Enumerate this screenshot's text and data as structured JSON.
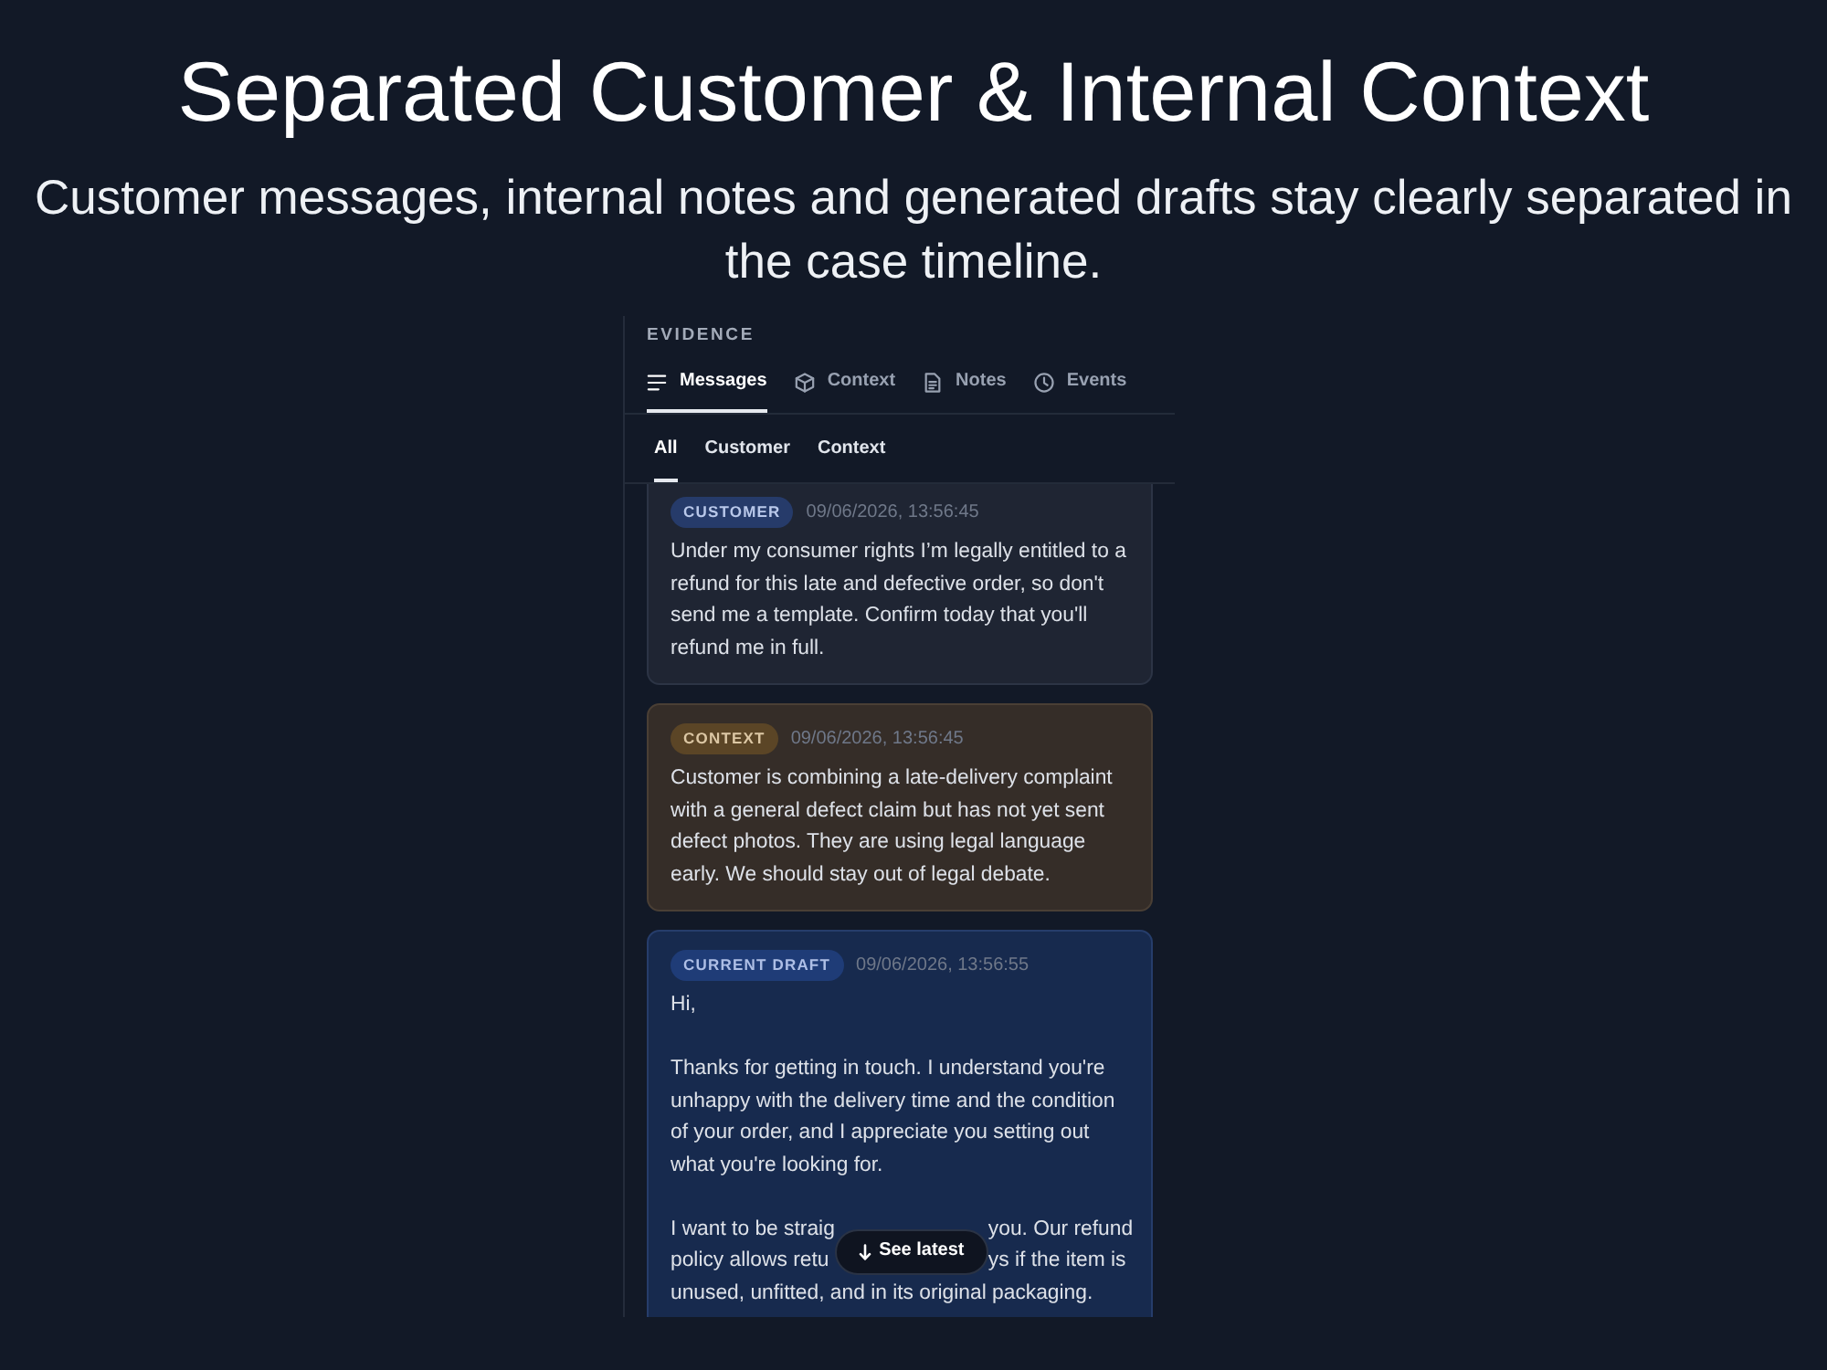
{
  "headline": {
    "title": "Separated Customer & Internal Context",
    "subtitle": "Customer messages, internal notes and generated drafts stay clearly separated in the case timeline."
  },
  "evidence": {
    "heading": "EVIDENCE",
    "tabs": [
      {
        "label": "Messages",
        "selected": true
      },
      {
        "label": "Context",
        "selected": false
      },
      {
        "label": "Notes",
        "selected": false
      },
      {
        "label": "Events",
        "selected": false
      }
    ],
    "filters": [
      {
        "label": "All",
        "selected": true
      },
      {
        "label": "Customer",
        "selected": false
      },
      {
        "label": "Context",
        "selected": false
      }
    ],
    "messages": [
      {
        "kind": "customer",
        "badge": "CUSTOMER",
        "time": "09/06/2026, 13:56:45",
        "paragraphs": [
          "Under my consumer rights I’m legally entitled to a refund for this late and defective order, so don't send me a template. Confirm today that you'll refund me in full."
        ]
      },
      {
        "kind": "context",
        "badge": "CONTEXT",
        "time": "09/06/2026, 13:56:45",
        "paragraphs": [
          "Customer is combining a late-delivery complaint with a general defect claim but has not yet sent defect photos. They are using legal language early. We should stay out of legal debate."
        ]
      },
      {
        "kind": "draft",
        "badge": "CURRENT DRAFT",
        "time": "09/06/2026, 13:56:55",
        "paragraphs": [
          "Hi,",
          "Thanks for getting in touch. I understand you're unhappy with the delivery time and the condition of your order, and I appreciate you setting out what you're looking for."
        ],
        "covered_lines": [
          {
            "left": "I want to be straig",
            "right": "you. Our refund"
          },
          {
            "left": "policy allows retu",
            "right": "ys if the item is"
          }
        ],
        "after_cover": "unused, unfitted, and in its original packaging."
      }
    ],
    "see_latest_button": {
      "label": "See latest"
    }
  }
}
